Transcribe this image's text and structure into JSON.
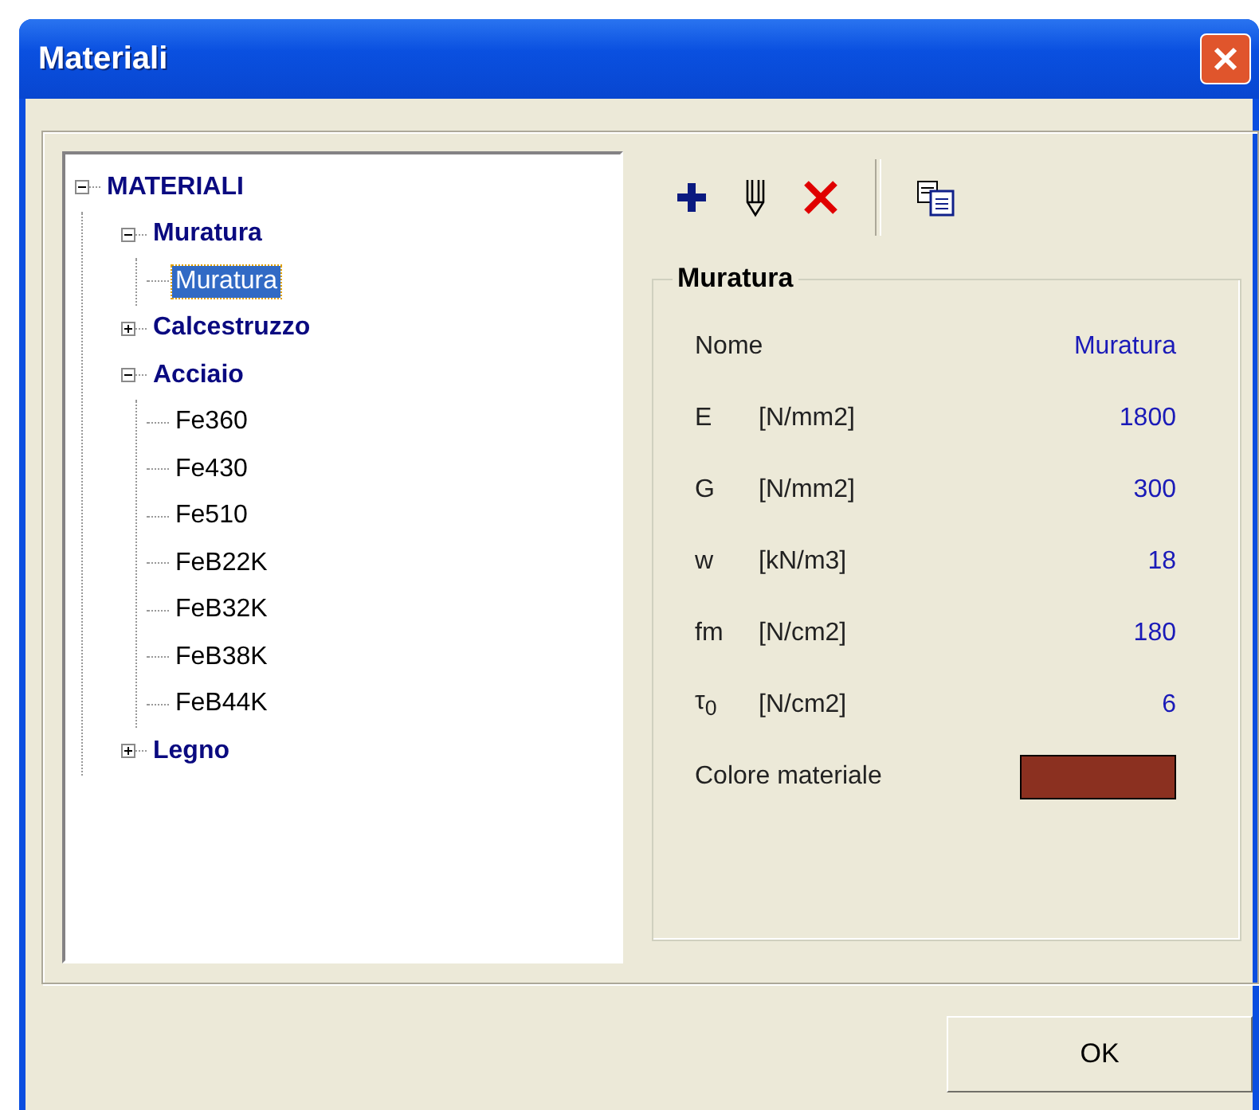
{
  "window": {
    "title": "Materiali"
  },
  "tree": [
    {
      "label": "MATERIALI",
      "expanded": true,
      "selected": false,
      "children": [
        {
          "label": "Muratura",
          "expanded": true,
          "selected": false,
          "children": [
            {
              "label": "Muratura",
              "selected": true
            }
          ]
        },
        {
          "label": "Calcestruzzo",
          "expanded": false,
          "selected": false
        },
        {
          "label": "Acciaio",
          "expanded": true,
          "selected": false,
          "children": [
            {
              "label": "Fe360",
              "selected": false
            },
            {
              "label": "Fe430",
              "selected": false
            },
            {
              "label": "Fe510",
              "selected": false
            },
            {
              "label": "FeB22K",
              "selected": false
            },
            {
              "label": "FeB32K",
              "selected": false
            },
            {
              "label": "FeB38K",
              "selected": false
            },
            {
              "label": "FeB44K",
              "selected": false
            }
          ]
        },
        {
          "label": "Legno",
          "expanded": false,
          "selected": false
        }
      ]
    }
  ],
  "properties": {
    "title": "Muratura",
    "rows": [
      {
        "kind": "text",
        "symbol": "Nome",
        "value": "Muratura"
      },
      {
        "kind": "text",
        "symbol": "E",
        "unit": "[N/mm2]",
        "value": "1800"
      },
      {
        "kind": "text",
        "symbol": "G",
        "unit": "[N/mm2]",
        "value": "300"
      },
      {
        "kind": "text",
        "symbol": "w",
        "unit": "[kN/m3]",
        "value": "18"
      },
      {
        "kind": "text",
        "symbol": "fm",
        "unit": "[N/cm2]",
        "value": "180"
      },
      {
        "kind": "text",
        "symbol": "τ$_{0}$",
        "unit": "[N/cm2]",
        "value": "6"
      },
      {
        "kind": "color",
        "symbol": "Colore materiale",
        "color": "#8b3020"
      }
    ]
  },
  "buttons": [
    "OK"
  ]
}
